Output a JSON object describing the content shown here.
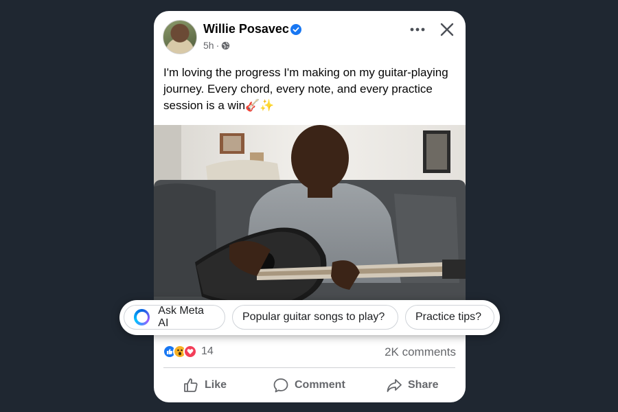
{
  "post": {
    "author": "Willie Posavec",
    "time": "5h",
    "separator": "·",
    "body": "I'm loving the progress I'm making on my guitar-playing journey. Every chord, every note, and every practice session is a win🎸✨",
    "reaction_count": "14",
    "comments": "2K comments"
  },
  "actions": {
    "like": "Like",
    "comment": "Comment",
    "share": "Share"
  },
  "chips": {
    "ask": "Ask Meta AI",
    "songs": "Popular guitar songs to play?",
    "tips": "Practice tips?"
  },
  "colors": {
    "background": "#1f2731",
    "card": "#ffffff",
    "verified": "#1877f2",
    "like": "#1877f2",
    "love": "#f33e58",
    "wow": "#f7b125"
  },
  "icons": [
    "verified-badge-icon",
    "globe-icon",
    "more-icon",
    "close-icon",
    "like-reaction-icon",
    "wow-reaction-icon",
    "love-reaction-icon",
    "thumbs-up-icon",
    "comment-bubble-icon",
    "share-arrow-icon",
    "meta-ai-ring-icon"
  ]
}
